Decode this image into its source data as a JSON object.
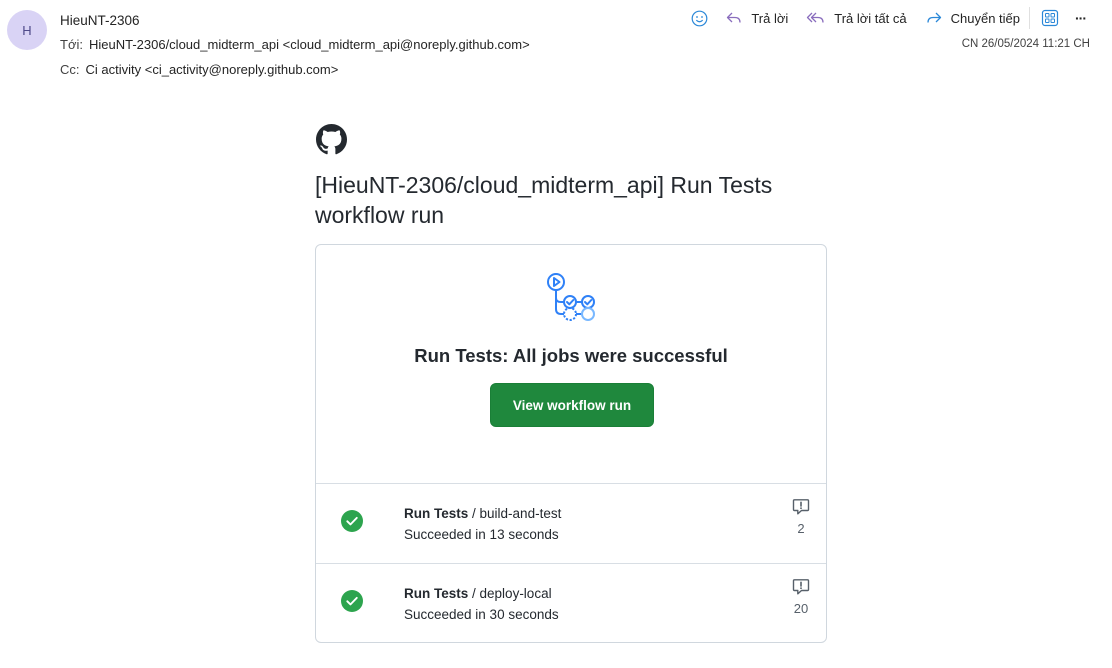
{
  "sender": {
    "avatar_initial": "H",
    "name": "HieuNT-2306",
    "to_label": "Tới:",
    "to_value": "HieuNT-2306/cloud_midterm_api <cloud_midterm_api@noreply.github.com>",
    "cc_label": "Cc:",
    "cc_value": "Ci activity <ci_activity@noreply.github.com>",
    "date": "CN 26/05/2024 11:21 CH"
  },
  "toolbar": {
    "reply": "Trả lời",
    "reply_all": "Trả lời tất cả",
    "forward": "Chuyển tiếp",
    "more": "···"
  },
  "email": {
    "title": "[HieuNT-2306/cloud_midterm_api] Run Tests workflow run",
    "heading": "Run Tests: All jobs were successful",
    "view_button": "View workflow run",
    "jobs": [
      {
        "workflow": "Run Tests",
        "sep": " / ",
        "name": "build-and-test",
        "status": "Succeeded in 13 seconds",
        "annotations": "2"
      },
      {
        "workflow": "Run Tests",
        "sep": " / ",
        "name": "deploy-local",
        "status": "Succeeded in 30 seconds",
        "annotations": "20"
      }
    ]
  },
  "colors": {
    "accent_green": "#1f883d",
    "success_green": "#2da44e",
    "workflow_blue": "#2f81f7",
    "reply_purple": "#8a6dbd",
    "forward_blue": "#2b88d8"
  }
}
